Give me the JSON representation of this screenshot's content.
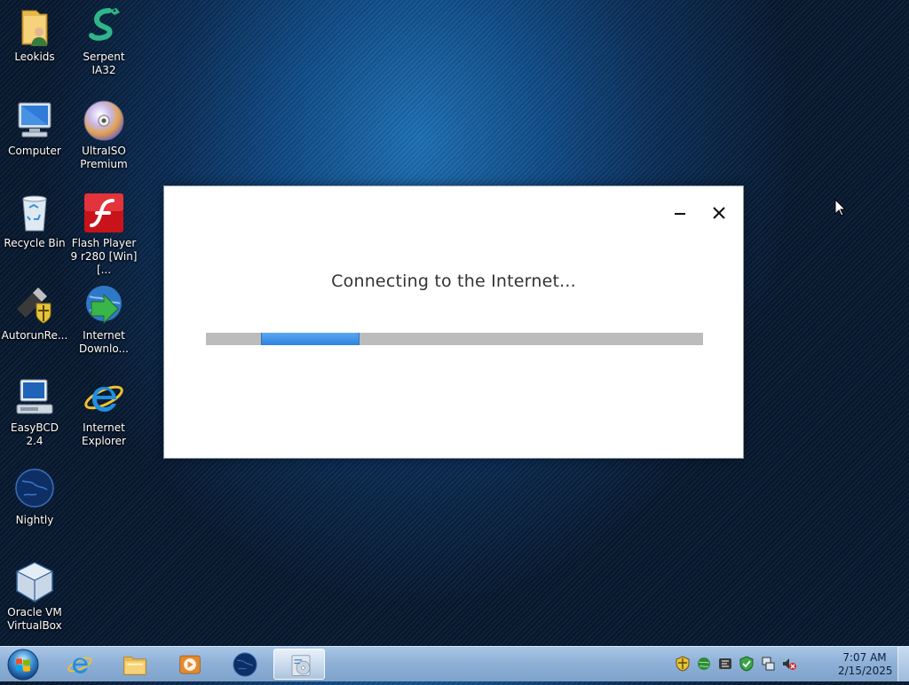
{
  "desktop": {
    "icons": [
      {
        "label": "Leokids",
        "icon": "user-folder-icon"
      },
      {
        "label": "Serpent IA32",
        "icon": "serpent-icon"
      },
      {
        "label": "Computer",
        "icon": "computer-icon"
      },
      {
        "label": "UltraISO Premium",
        "icon": "disc-icon"
      },
      {
        "label": "Recycle Bin",
        "icon": "recycle-bin-icon"
      },
      {
        "label": "Flash Player 9 r280 [Win] [...",
        "icon": "flash-icon"
      },
      {
        "label": "AutorunRe...",
        "icon": "usb-shield-icon"
      },
      {
        "label": "Internet Downlo...",
        "icon": "download-globe-icon"
      },
      {
        "label": "EasyBCD 2.4",
        "icon": "easybcd-icon"
      },
      {
        "label": "Internet Explorer",
        "icon": "ie-icon"
      },
      {
        "label": "Nightly",
        "icon": "nightly-globe-icon"
      },
      {
        "label": "Oracle VM VirtualBox",
        "icon": "virtualbox-icon"
      }
    ]
  },
  "dialog": {
    "title": "Connecting to the Internet...",
    "progress": 0.2,
    "minimize_icon": "minimize-icon",
    "close_icon": "close-icon"
  },
  "taskbar": {
    "start_icon": "windows-orb-icon",
    "pinned": [
      {
        "name": "internet-explorer",
        "icon": "ie-icon"
      },
      {
        "name": "file-explorer",
        "icon": "folder-icon"
      },
      {
        "name": "media-player",
        "icon": "media-player-icon"
      },
      {
        "name": "nightly",
        "icon": "nightly-globe-icon"
      },
      {
        "name": "setup",
        "icon": "setup-disc-icon",
        "active": true
      }
    ],
    "tray_icons": [
      "shield-icon",
      "network-globe-icon",
      "utility-icon",
      "security-check-icon",
      "network-icon",
      "speaker-muted-icon"
    ],
    "clock": {
      "time": "7:07 AM",
      "date": "2/15/2025"
    }
  },
  "colors": {
    "accent": "#2e82de",
    "progress_track": "#bcbcbc",
    "desktop_dark": "#06182f"
  }
}
